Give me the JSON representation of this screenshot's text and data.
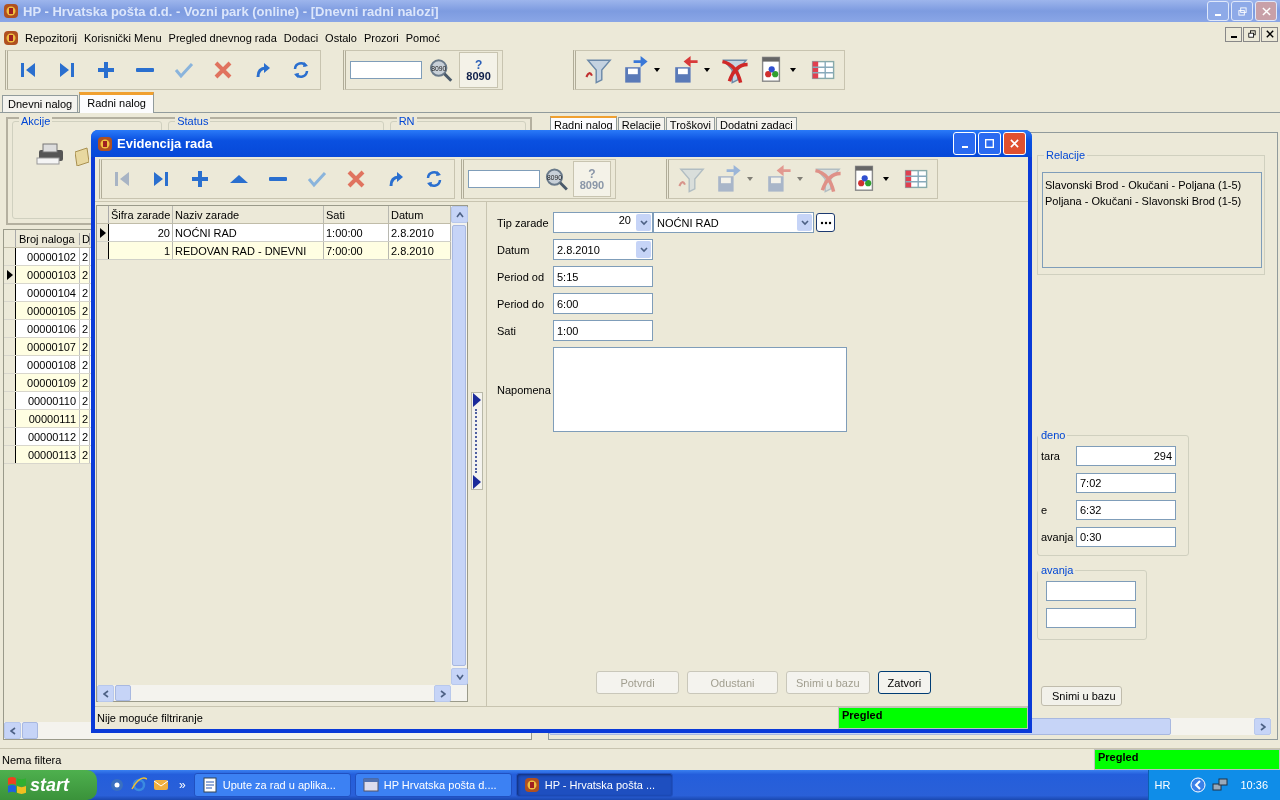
{
  "window": {
    "title": "HP - Hrvatska pošta d.d. - Vozni park (online) - [Dnevni radni nalozi]"
  },
  "menu": [
    "Repozitorij",
    "Korisnički Menu",
    "Pregled dnevnog rada",
    "Dodaci",
    "Ostalo",
    "Prozori",
    "Pomoć"
  ],
  "toolbar": {
    "nav": [
      {
        "kind": "first",
        "disabled": false
      },
      {
        "kind": "last",
        "disabled": false
      },
      {
        "kind": "add",
        "disabled": false
      },
      {
        "kind": "remove",
        "disabled": false
      },
      {
        "kind": "confirm",
        "disabled": false
      },
      {
        "kind": "cancel",
        "disabled": false
      },
      {
        "kind": "redo",
        "disabled": false
      },
      {
        "kind": "refresh",
        "disabled": false
      }
    ],
    "find_label": "8090",
    "code_button": {
      "mark": "?",
      "label": "8090",
      "disabled": false
    },
    "tools": [
      {
        "kind": "filter",
        "dropdown": false,
        "disabled": false
      },
      {
        "kind": "export",
        "dropdown": true,
        "disabled": false
      },
      {
        "kind": "import",
        "dropdown": true,
        "disabled": false
      },
      {
        "kind": "unfilter",
        "dropdown": false,
        "disabled": false
      },
      {
        "kind": "report",
        "dropdown": true,
        "disabled": false
      },
      {
        "kind": "columns",
        "dropdown": false,
        "disabled": false
      }
    ]
  },
  "tabs": [
    {
      "label": "Dnevni nalog",
      "selected": false
    },
    {
      "label": "Radni nalog",
      "selected": true
    }
  ],
  "left_panel": {
    "groups": [
      "Akcije",
      "Status",
      "RN"
    ],
    "grid": {
      "columns": [
        "Broj naloga",
        "D"
      ],
      "rows": [
        {
          "cells": [
            "00000102",
            "2"
          ],
          "selected": false
        },
        {
          "cells": [
            "00000103",
            "2"
          ],
          "selected": true
        },
        {
          "cells": [
            "00000104",
            "2"
          ],
          "selected": false
        },
        {
          "cells": [
            "00000105",
            "2"
          ],
          "selected": false
        },
        {
          "cells": [
            "00000106",
            "2"
          ],
          "selected": false
        },
        {
          "cells": [
            "00000107",
            "2"
          ],
          "selected": false
        },
        {
          "cells": [
            "00000108",
            "2"
          ],
          "selected": false
        },
        {
          "cells": [
            "00000109",
            "2"
          ],
          "selected": false
        },
        {
          "cells": [
            "00000110",
            "2"
          ],
          "selected": false
        },
        {
          "cells": [
            "00000111",
            "2"
          ],
          "selected": false
        },
        {
          "cells": [
            "00000112",
            "2"
          ],
          "selected": false
        },
        {
          "cells": [
            "00000113",
            "2"
          ],
          "selected": false
        }
      ]
    }
  },
  "right_panel": {
    "tabs": [
      {
        "label": "Radni nalog",
        "selected": true
      },
      {
        "label": "Relacije",
        "selected": false
      },
      {
        "label": "Troškovi",
        "selected": false
      },
      {
        "label": "Dodatni zadaci",
        "selected": false
      }
    ],
    "relations": {
      "title": "Relacije",
      "items": [
        "Slavonski Brod - Okučani - Poljana (1-5)",
        "Poljana - Okučani - Slavonski Brod (1-5)"
      ]
    },
    "summary": {
      "title": "đeno",
      "fields": [
        {
          "label": "tara",
          "value": "294",
          "kind": "number"
        },
        {
          "value": "7:02",
          "kind": "text"
        },
        {
          "label": "e",
          "value": "6:32",
          "kind": "text"
        },
        {
          "label": "avanja",
          "value": "0:30",
          "kind": "text"
        }
      ]
    },
    "second_group": {
      "title": "avanja",
      "fields": [
        {
          "kind": "text"
        },
        {
          "kind": "text"
        }
      ]
    },
    "save_button": "Snimi u bazu"
  },
  "status_bar": {
    "text": "Nema filtera",
    "mode": "Pregled"
  },
  "dialog": {
    "title": "Evidencija rada",
    "toolbar": [
      {
        "kind": "first",
        "disabled": true
      },
      {
        "kind": "last",
        "disabled": false
      },
      {
        "kind": "add",
        "disabled": false
      },
      {
        "kind": "up",
        "disabled": false
      },
      {
        "kind": "remove",
        "disabled": false
      },
      {
        "kind": "confirm",
        "disabled": false
      },
      {
        "kind": "cancel",
        "disabled": false
      },
      {
        "kind": "redo",
        "disabled": false
      },
      {
        "kind": "refresh",
        "disabled": false
      }
    ],
    "find_label": "8090",
    "code_button": {
      "mark": "?",
      "label": "8090",
      "disabled": true
    },
    "tools": [
      {
        "kind": "filter",
        "dropdown": false,
        "disabled": true
      },
      {
        "kind": "export",
        "dropdown": true,
        "disabled": true
      },
      {
        "kind": "import",
        "dropdown": true,
        "disabled": true
      },
      {
        "kind": "unfilter",
        "dropdown": false,
        "disabled": true
      },
      {
        "kind": "report",
        "dropdown": true,
        "disabled": false
      },
      {
        "kind": "columns",
        "dropdown": false,
        "disabled": false
      }
    ],
    "grid": {
      "columns": [
        "Šifra zarade",
        "Naziv zarade",
        "Sati",
        "Datum"
      ],
      "rows": [
        {
          "cells": [
            "20",
            "NOĆNI RAD",
            "1:00:00",
            "2.8.2010"
          ],
          "selected": true
        },
        {
          "cells": [
            "1",
            "REDOVAN RAD - DNEVNI",
            "7:00:00",
            "2.8.2010"
          ],
          "selected": false
        }
      ]
    },
    "form": {
      "type": {
        "label": "Tip zarade",
        "code": "20",
        "name": "NOĆNI RAD"
      },
      "fields": [
        {
          "label": "Datum",
          "value": "2.8.2010",
          "kind": "date"
        },
        {
          "label": "Period od",
          "value": "5:15",
          "kind": "text"
        },
        {
          "label": "Period do",
          "value": "6:00",
          "kind": "text"
        },
        {
          "label": "Sati",
          "value": "1:00",
          "kind": "text"
        }
      ],
      "note": {
        "label": "Napomena"
      }
    },
    "buttons": [
      {
        "label": "Potvrdi",
        "disabled": true
      },
      {
        "label": "Odustani",
        "disabled": true
      },
      {
        "label": "Snimi u bazu",
        "disabled": true
      },
      {
        "label": "Zatvori",
        "disabled": false
      }
    ],
    "status_bar": {
      "text": "Nije moguće filtriranje",
      "mode": "Pregled"
    }
  },
  "taskbar": {
    "start": "start",
    "more": "»",
    "tasks": [
      {
        "label": "Upute za rad u aplika...",
        "kind": "document",
        "selected": false
      },
      {
        "label": "HP Hrvatska pošta d....",
        "kind": "app",
        "selected": false
      },
      {
        "label": "HP - Hrvatska pošta ...",
        "kind": "logo",
        "selected": true
      }
    ],
    "language": "HR",
    "time": "10:36"
  }
}
